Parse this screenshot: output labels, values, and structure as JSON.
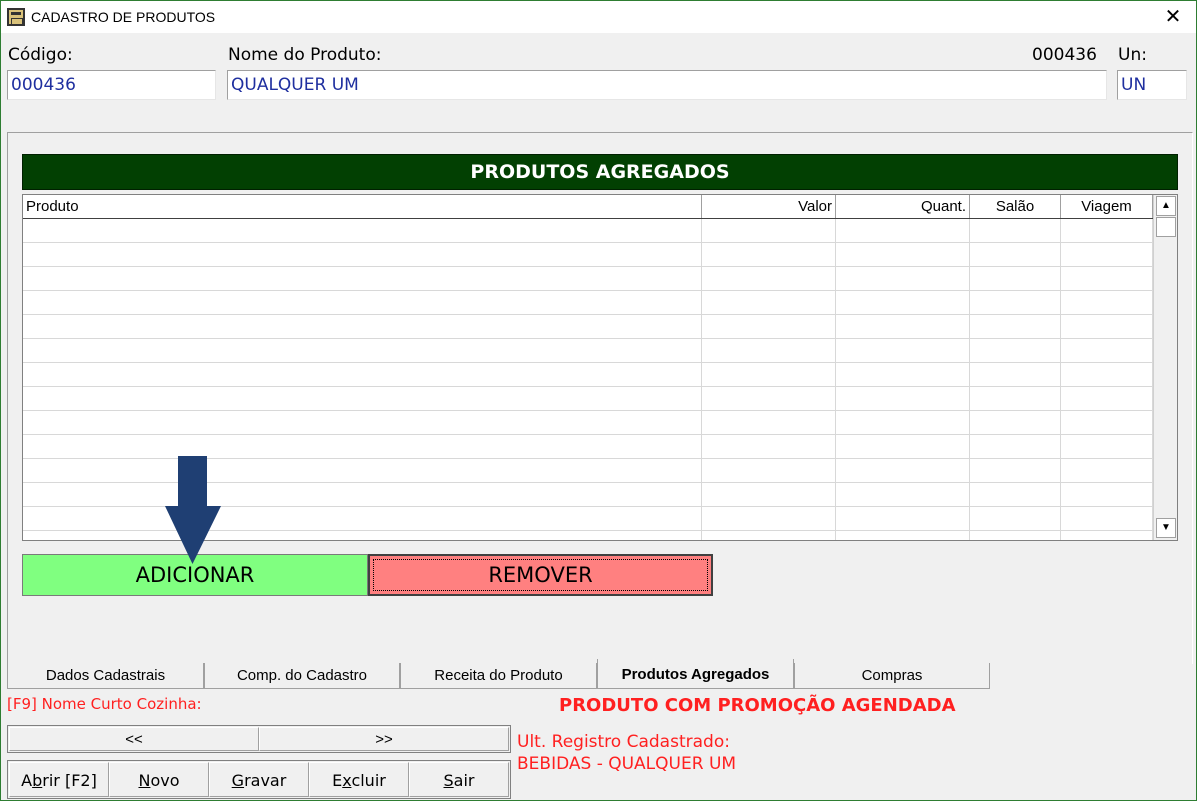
{
  "window": {
    "title": "CADASTRO DE PRODUTOS",
    "close_glyph": "✕",
    "border_color": "#2e7d32"
  },
  "header": {
    "codigo_label": "Código:",
    "codigo_value": "000436",
    "nome_label": "Nome do Produto:",
    "nome_value": "QUALQUER UM",
    "id_display": "000436",
    "un_label": "Un:",
    "un_value": "UN"
  },
  "section": {
    "title": "PRODUTOS AGREGADOS",
    "bg_color": "#024002"
  },
  "grid": {
    "columns": [
      "Produto",
      "Valor",
      "Quant.",
      "Salão",
      "Viagem"
    ],
    "rows": [
      [
        "",
        "",
        "",
        "",
        ""
      ],
      [
        "",
        "",
        "",
        "",
        ""
      ],
      [
        "",
        "",
        "",
        "",
        ""
      ],
      [
        "",
        "",
        "",
        "",
        ""
      ],
      [
        "",
        "",
        "",
        "",
        ""
      ],
      [
        "",
        "",
        "",
        "",
        ""
      ],
      [
        "",
        "",
        "",
        "",
        ""
      ],
      [
        "",
        "",
        "",
        "",
        ""
      ],
      [
        "",
        "",
        "",
        "",
        ""
      ],
      [
        "",
        "",
        "",
        "",
        ""
      ],
      [
        "",
        "",
        "",
        "",
        ""
      ],
      [
        "",
        "",
        "",
        "",
        ""
      ],
      [
        "",
        "",
        "",
        "",
        ""
      ],
      [
        "",
        "",
        "",
        "",
        ""
      ]
    ],
    "scroll_up_glyph": "▲",
    "scroll_down_glyph": "▼"
  },
  "actions": {
    "add_label": "ADICIONAR",
    "remove_label": "REMOVER",
    "add_color": "#80ff80",
    "remove_color": "#ff8080"
  },
  "tabs": [
    {
      "label": "Dados Cadastrais",
      "active": false
    },
    {
      "label": "Comp. do Cadastro",
      "active": false
    },
    {
      "label": "Receita do Produto",
      "active": false
    },
    {
      "label": "Produtos Agregados",
      "active": true
    },
    {
      "label": "Compras",
      "active": false
    }
  ],
  "status": {
    "f9_hint": "[F9] Nome Curto Cozinha:",
    "promo_notice": "PRODUTO COM PROMOÇÃO AGENDADA",
    "last_record_label": "Ult. Registro Cadastrado:",
    "last_record_value": "BEBIDAS - QUALQUER UM",
    "alert_color": "#ff2020"
  },
  "nav": {
    "prev_label": "<<",
    "next_label": ">>"
  },
  "toolbar": [
    {
      "label": "Abrir [F2]",
      "hotkey": "b"
    },
    {
      "label": "Novo",
      "hotkey": "N"
    },
    {
      "label": "Gravar",
      "hotkey": "G"
    },
    {
      "label": "Excluir",
      "hotkey": "x"
    },
    {
      "label": "Sair",
      "hotkey": "S"
    }
  ],
  "annotation": {
    "arrow_color": "#1f3f73",
    "arrow_icon": "arrow-down-icon"
  }
}
